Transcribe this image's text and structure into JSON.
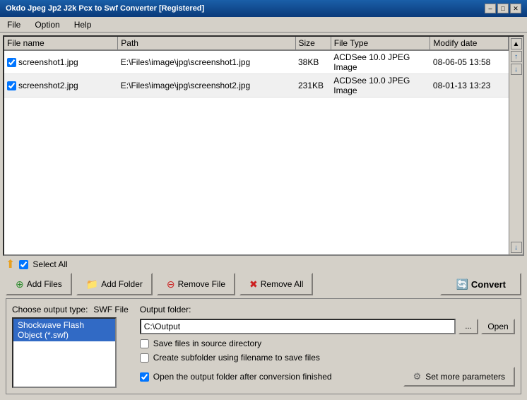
{
  "titleBar": {
    "text": "Okdo Jpeg Jp2 J2k Pcx to Swf Converter [Registered]",
    "minimize": "–",
    "maximize": "□",
    "close": "✕"
  },
  "menuBar": {
    "items": [
      {
        "label": "File",
        "id": "file"
      },
      {
        "label": "Option",
        "id": "option"
      },
      {
        "label": "Help",
        "id": "help"
      }
    ]
  },
  "fileTable": {
    "columns": [
      {
        "label": "File name",
        "id": "filename"
      },
      {
        "label": "Path",
        "id": "path"
      },
      {
        "label": "Size",
        "id": "size"
      },
      {
        "label": "File Type",
        "id": "filetype"
      },
      {
        "label": "Modify date",
        "id": "modifydate"
      }
    ],
    "rows": [
      {
        "checked": true,
        "filename": "screenshot1.jpg",
        "path": "E:\\Files\\image\\jpg\\screenshot1.jpg",
        "size": "38KB",
        "filetype": "ACDSee 10.0 JPEG Image",
        "modifydate": "08-06-05 13:58"
      },
      {
        "checked": true,
        "filename": "screenshot2.jpg",
        "path": "E:\\Files\\image\\jpg\\screenshot2.jpg",
        "size": "231KB",
        "filetype": "ACDSee 10.0 JPEG Image",
        "modifydate": "08-01-13 13:23"
      }
    ]
  },
  "scrollButtons": {
    "top": "▲",
    "up": "↑",
    "down": "↓",
    "bottom": "↓"
  },
  "selectAll": {
    "label": "Select All",
    "checked": true
  },
  "backButton": "⬆",
  "buttons": {
    "addFiles": "Add Files",
    "addFolder": "Add Folder",
    "removeFile": "Remove File",
    "removeAll": "Remove All",
    "convert": "Convert"
  },
  "outputType": {
    "label": "Choose output type:",
    "currentType": "SWF File",
    "options": [
      {
        "label": "Shockwave Flash Object (*.swf)",
        "selected": true
      }
    ]
  },
  "outputFolder": {
    "label": "Output folder:",
    "value": "C:\\Output",
    "browseLabel": "...",
    "openLabel": "Open"
  },
  "checkboxes": {
    "saveInSource": {
      "label": "Save files in source directory",
      "checked": false
    },
    "createSubfolder": {
      "label": "Create subfolder using filename to save files",
      "checked": false
    },
    "openAfterConversion": {
      "label": "Open the output folder after conversion finished",
      "checked": true
    }
  },
  "setParamsButton": "Set more parameters"
}
